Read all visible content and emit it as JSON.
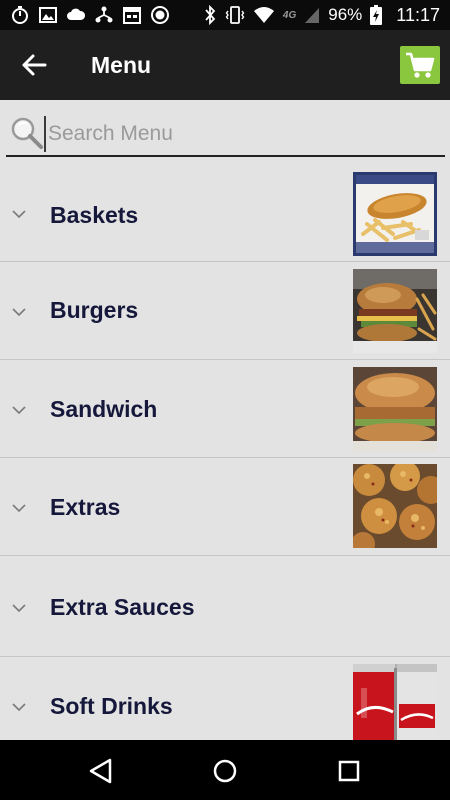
{
  "status_bar": {
    "left_icons": [
      "stopwatch-icon",
      "image-icon",
      "cloud-icon",
      "network-icon",
      "calendar-icon",
      "record-icon"
    ],
    "network_tag": "4G",
    "battery": "96%",
    "time": "11:17"
  },
  "app_bar": {
    "title": "Menu"
  },
  "search": {
    "placeholder": "Search Menu"
  },
  "menu": {
    "items": [
      {
        "label": "Baskets",
        "thumb": "fish-and-chips-photo"
      },
      {
        "label": "Burgers",
        "thumb": "burger-photo"
      },
      {
        "label": "Sandwich",
        "thumb": "sandwich-photo"
      },
      {
        "label": "Extras",
        "thumb": "crab-cakes-photo"
      },
      {
        "label": "Extra Sauces",
        "thumb": ""
      },
      {
        "label": "Soft Drinks",
        "thumb": "soda-cans-photo"
      }
    ]
  },
  "colors": {
    "app_bar": "#1f1f1f",
    "cart_button": "#8bc63f",
    "item_text": "#15183a",
    "background": "#e3e3e3"
  }
}
